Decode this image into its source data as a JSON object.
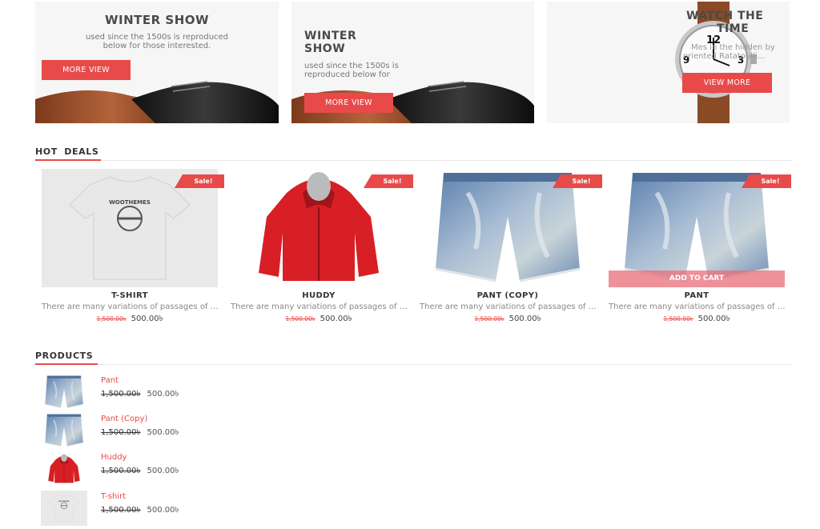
{
  "banners": [
    {
      "title": "WINTER SHOW",
      "subtitle": "used since the 1500s is reproduced below for those interested.",
      "button": "MORE VIEW"
    },
    {
      "title_line1": "WINTER",
      "title_line2": "SHOW",
      "subtitle_line1": "used since the 1500s is",
      "subtitle_line2": "reproduced below for",
      "button": "MORE VIEW"
    },
    {
      "title_line1": "WATCH THE",
      "title_line2": "TIME",
      "subtitle_line1": "Mes in the hidden by",
      "subtitle_line2": "oriented Ratatoulli...",
      "button": "VIEW MORE"
    }
  ],
  "hot_deals": {
    "title": "HOT DEALS",
    "products": [
      {
        "name": "T-SHIRT",
        "desc": "There are many variations of passages of Lorem Ipsum",
        "old_price": "1,500.00৳",
        "price": "500.00৳",
        "sale": "Sale!"
      },
      {
        "name": "HUDDY",
        "desc": "There are many variations of passages of Lorem Ipsum",
        "old_price": "1,500.00৳",
        "price": "500.00৳",
        "sale": "Sale!"
      },
      {
        "name": "PANT (COPY)",
        "desc": "There are many variations of passages of Lorem Ipsum",
        "old_price": "1,500.00৳",
        "price": "500.00৳",
        "sale": "Sale!"
      },
      {
        "name": "PANT",
        "desc": "There are many variations of passages of Lorem Ipsum",
        "old_price": "1,500.00৳",
        "price": "500.00৳",
        "sale": "Sale!",
        "cart_label": "ADD TO CART"
      }
    ]
  },
  "products": {
    "title": "PRODUCTS",
    "items": [
      {
        "name": "Pant",
        "old_price": "1,500.00৳",
        "price": "500.00৳"
      },
      {
        "name": "Pant (Copy)",
        "old_price": "1,500.00৳",
        "price": "500.00৳"
      },
      {
        "name": "Huddy",
        "old_price": "1,500.00৳",
        "price": "500.00৳"
      },
      {
        "name": "T-shirt",
        "old_price": "1,500.00৳",
        "price": "500.00৳"
      }
    ]
  },
  "colors": {
    "accent": "#e84a4a",
    "text": "#333333",
    "muted": "#888888"
  }
}
